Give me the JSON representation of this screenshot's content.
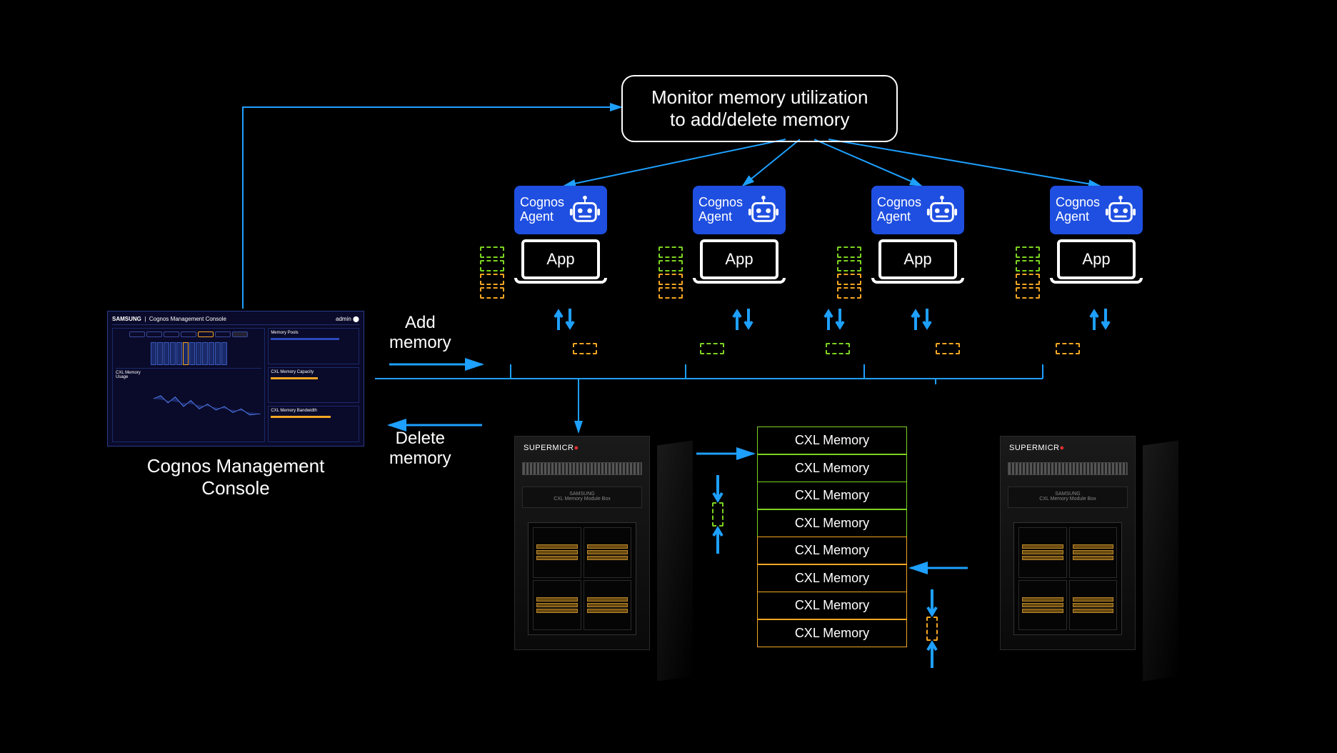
{
  "monitor": {
    "line1": "Monitor memory utilization",
    "line2": "to add/delete memory"
  },
  "agents": [
    {
      "title_line1": "Cognos",
      "title_line2": "Agent",
      "app_label": "App"
    },
    {
      "title_line1": "Cognos",
      "title_line2": "Agent",
      "app_label": "App"
    },
    {
      "title_line1": "Cognos",
      "title_line2": "Agent",
      "app_label": "App"
    },
    {
      "title_line1": "Cognos",
      "title_line2": "Agent",
      "app_label": "App"
    }
  ],
  "actions": {
    "add_line1": "Add",
    "add_line2": "memory",
    "delete_line1": "Delete",
    "delete_line2": "memory"
  },
  "console": {
    "brand": "SAMSUNG",
    "title": "Cognos Management Console",
    "caption_line1": "Cognos Management",
    "caption_line2": "Console",
    "side_label1": "Memory Pools",
    "side_label2": "CXL Memory Capacity",
    "side_label3": "CXL Memory Bandwidth",
    "chart_label": "CXL Memory Usage"
  },
  "cxl": {
    "green": [
      "CXL Memory",
      "CXL Memory",
      "CXL Memory",
      "CXL Memory"
    ],
    "orange": [
      "CXL Memory",
      "CXL Memory",
      "CXL Memory",
      "CXL Memory"
    ]
  },
  "rack": {
    "brand": "SUPERMICR",
    "panel_brand": "SAMSUNG",
    "panel_text": "CXL Memory Module Box"
  },
  "colors": {
    "arrow": "#1ea0ff",
    "green": "#7dd321",
    "orange": "#f5a623",
    "agent_bg": "#1f4fe0"
  }
}
